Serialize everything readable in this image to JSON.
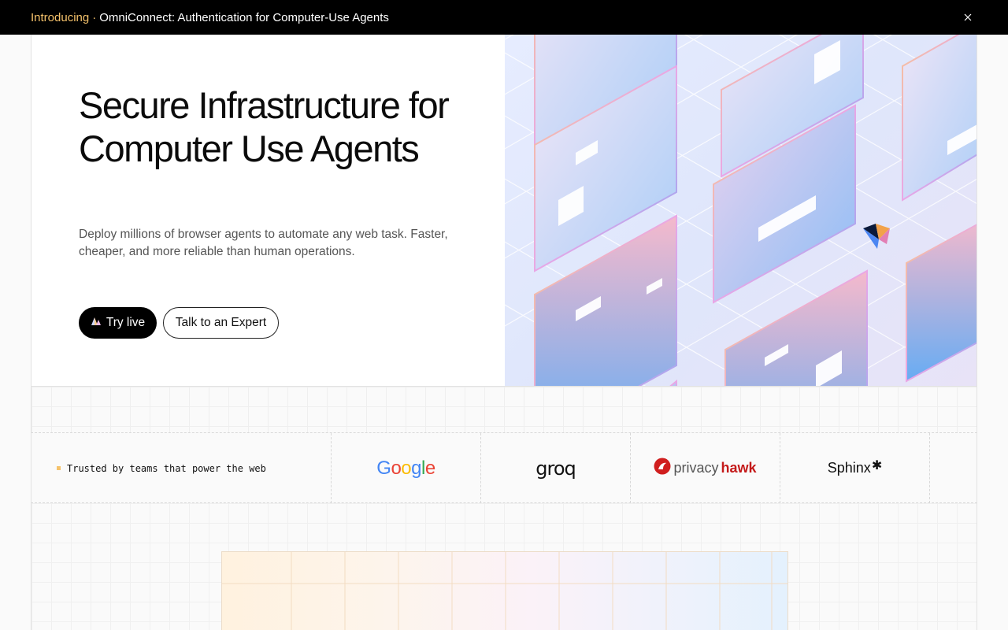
{
  "announcement": {
    "intro": "Introducing",
    "separator": "·",
    "text": "OmniConnect: Authentication for Computer-Use Agents",
    "close_icon": "close-icon"
  },
  "hero": {
    "title": "Secure Infrastructure for Computer Use Agents",
    "subtitle": "Deploy millions of browser agents to automate any web task. Faster, cheaper, and more reliable than human operations.",
    "primary_button": "Try live",
    "primary_button_icon": "sparkle-icon",
    "secondary_button": "Talk to an Expert"
  },
  "trusted": {
    "label": "Trusted by teams that power the web",
    "logos": [
      {
        "name": "Google",
        "text": "Google"
      },
      {
        "name": "groq",
        "text": "groq"
      },
      {
        "name": "privacyhawk",
        "text_a": "privacy",
        "text_b": "hawk"
      },
      {
        "name": "Sphinx",
        "text": "Sphinx"
      }
    ]
  },
  "colors": {
    "accent": "#f5c26b",
    "black": "#000000",
    "google_blue": "#4285F4",
    "google_red": "#EA4335",
    "google_yellow": "#FBBC05",
    "google_green": "#34A853",
    "privacyhawk_red": "#d01e1e"
  }
}
